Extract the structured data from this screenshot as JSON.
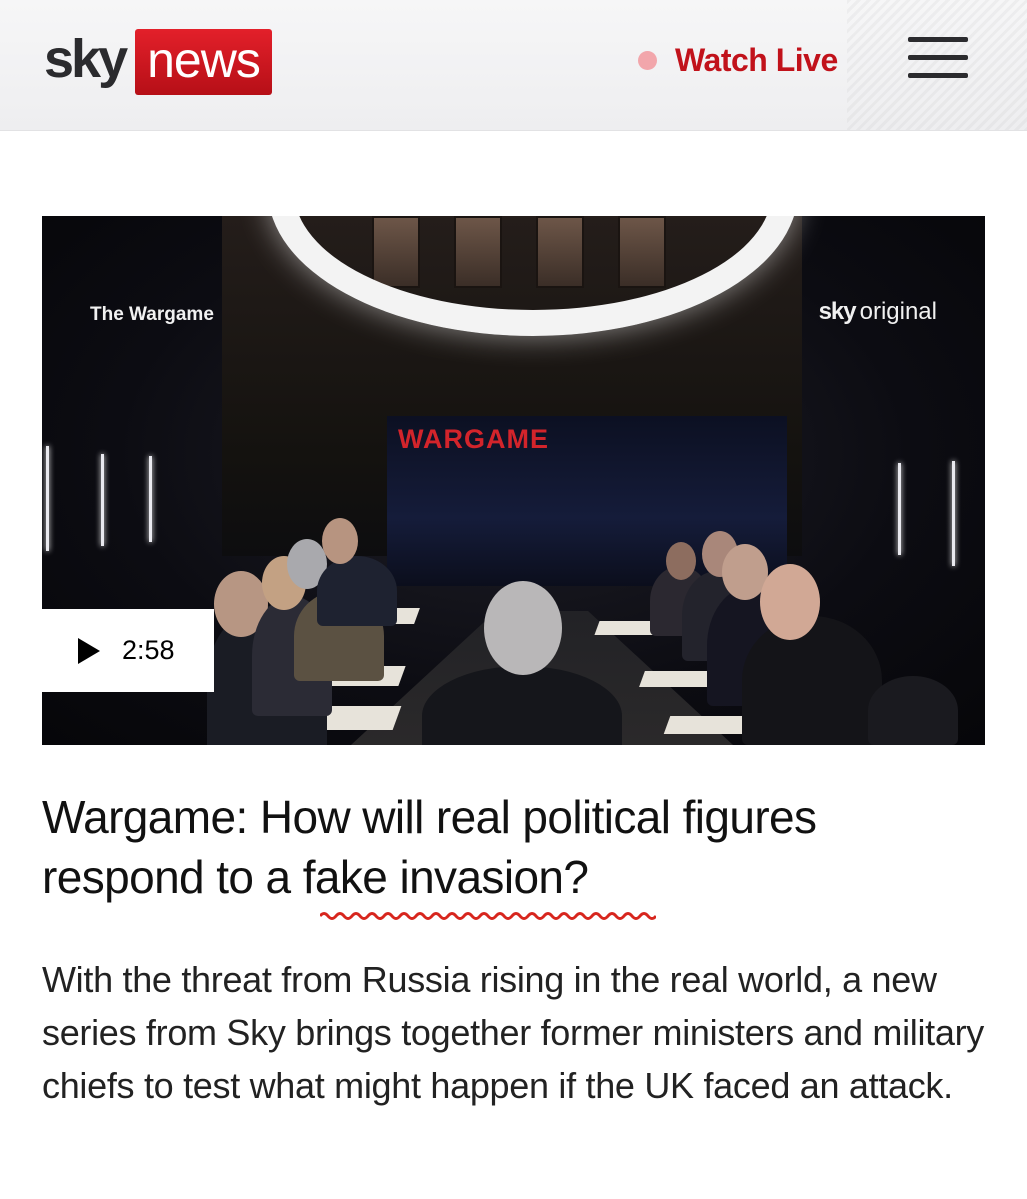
{
  "header": {
    "logo": {
      "sky": "sky",
      "news": "news"
    },
    "watch_live": "Watch Live",
    "menu_icon": "hamburger-menu-icon"
  },
  "video": {
    "series_label": "The Wargame",
    "brand_label_sky": "sky",
    "brand_label_original": "original",
    "screen_title": "WARGAME",
    "duration": "2:58",
    "play_icon": "play-icon"
  },
  "article": {
    "headline": "Wargame: How will real political figures respond to a fake invasion?",
    "standfirst": "With the threat from Russia rising in the real world, a new series from Sky brings together former ministers and military chiefs to test what might happen if the UK faced an attack."
  },
  "colors": {
    "brand_red": "#c1121b",
    "live_dot": "#f2a6ab",
    "squiggle": "#d7261e"
  }
}
